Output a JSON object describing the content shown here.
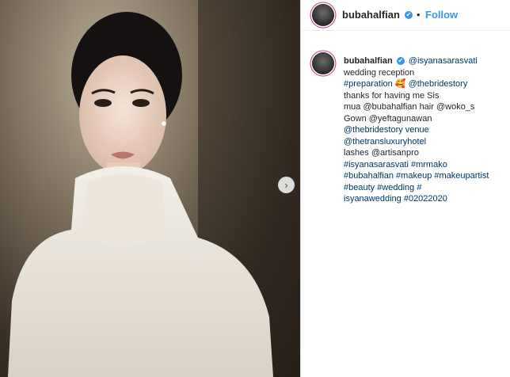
{
  "post": {
    "username": "bubahalfian",
    "follow_label": "Follow",
    "separator": "•",
    "verified_icon": "✔",
    "next_icon": "›"
  },
  "caption": {
    "username": "bubahalfian",
    "lines": [
      "@isyanasarasvati",
      "wedding reception",
      "#preparation 🥰 @thebridestory",
      "thanks for having me Sis",
      "mua @bubahalfian hair @woko_s",
      "Gown @yeftagunawan",
      "@thebridestory venue",
      "@thetransluxuryhotel",
      "lashes @artisanpro",
      "#isyanasarasvati #mrmako",
      "#bubahalfian #makeup #makeupartist",
      "#beauty #wedding #",
      "isyanawedding #02022020"
    ]
  },
  "colors": {
    "link": "#00376b",
    "follow": "#3897f0",
    "text": "#262626"
  }
}
